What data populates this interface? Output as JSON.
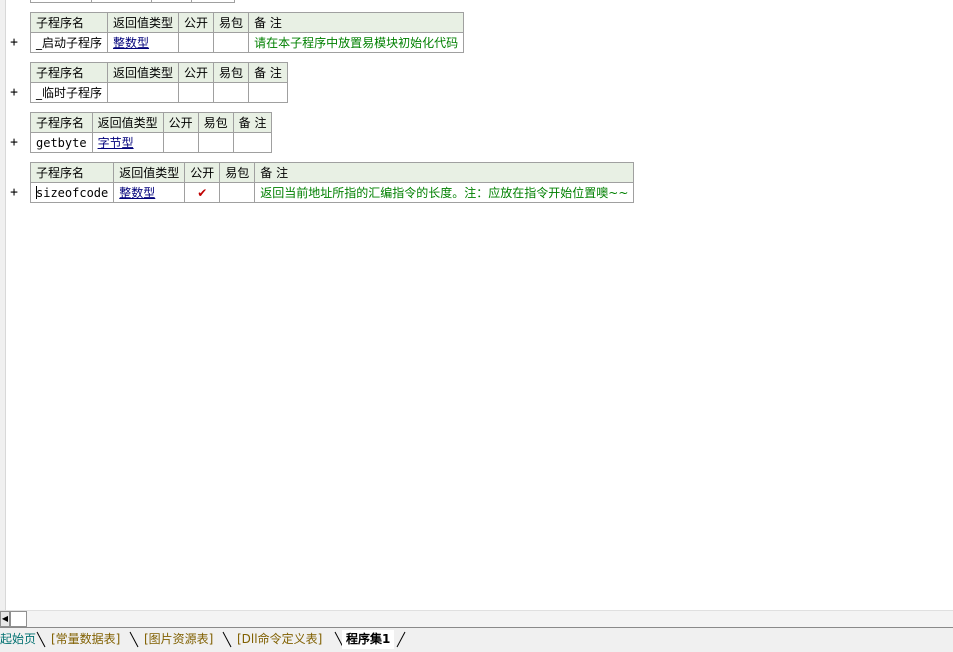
{
  "columns": {
    "name": "子程序名",
    "return_type": "返回值类型",
    "public": "公开",
    "package": "易包",
    "note": "备 注"
  },
  "expander_symbol": "+",
  "subroutines": [
    {
      "name": "_启动子程序",
      "return_type": "整数型",
      "public": "",
      "package": "",
      "note": "请在本子程序中放置易模块初始化代码"
    },
    {
      "name": "_临时子程序",
      "return_type": "",
      "public": "",
      "package": "",
      "note": ""
    },
    {
      "name": "getbyte",
      "return_type": "字节型",
      "public": "",
      "package": "",
      "note": ""
    },
    {
      "name": "sizeofcode",
      "return_type": "整数型",
      "public": "✔",
      "package": "",
      "note": "返回当前地址所指的汇编指令的长度。注：应放在指令开始位置噢~~"
    }
  ],
  "tabs": [
    {
      "label": "起始页",
      "style": "teal"
    },
    {
      "label": "[常量数据表]",
      "style": "gold"
    },
    {
      "label": "[图片资源表]",
      "style": "gold"
    },
    {
      "label": "[Dll命令定义表]",
      "style": "gold"
    },
    {
      "label": "程序集1",
      "style": "active"
    }
  ],
  "colors": {
    "header_bg": "#e8f0e4",
    "type_link": "#00007a",
    "note_text": "#008000",
    "check_mark": "#c00000"
  }
}
